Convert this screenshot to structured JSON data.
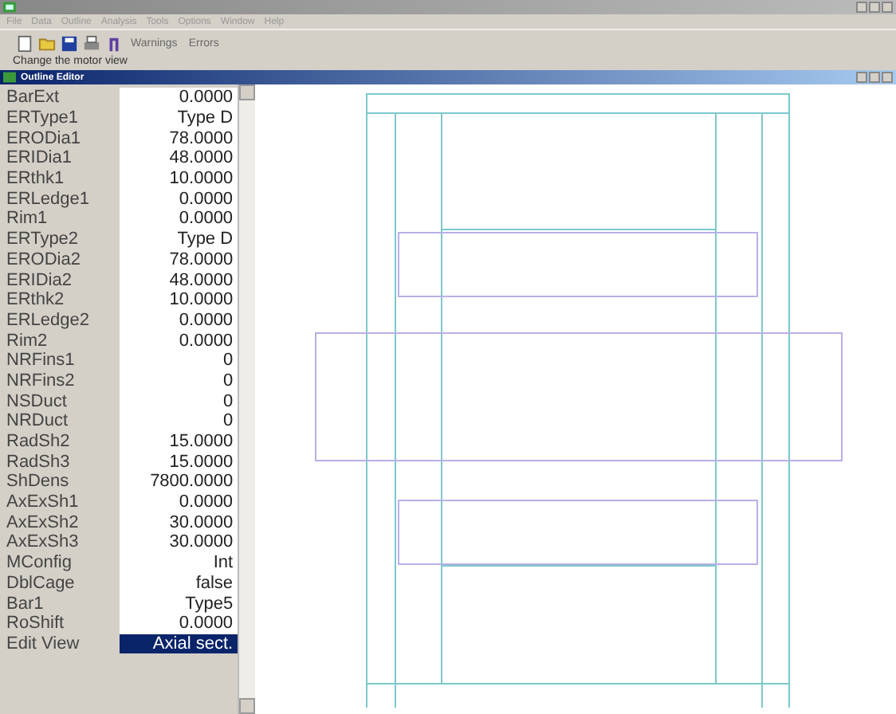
{
  "menu": [
    {
      "label": "File"
    },
    {
      "label": "Data"
    },
    {
      "label": "Outline"
    },
    {
      "label": "Analysis"
    },
    {
      "label": "Tools"
    },
    {
      "label": "Options"
    },
    {
      "label": "Window"
    },
    {
      "label": "Help"
    }
  ],
  "toolbar": {
    "buttons": [
      "Warnings",
      "Errors"
    ]
  },
  "hint": "Change the motor view",
  "editor": {
    "title": "Outline Editor",
    "properties": [
      {
        "name": "BarExt",
        "value": "0.0000",
        "selected": false
      },
      {
        "name": "ERType1",
        "value": "Type D",
        "selected": false
      },
      {
        "name": "ERODia1",
        "value": "78.0000",
        "selected": false
      },
      {
        "name": "ERIDia1",
        "value": "48.0000",
        "selected": false
      },
      {
        "name": "ERthk1",
        "value": "10.0000",
        "selected": false
      },
      {
        "name": "ERLedge1",
        "value": "0.0000",
        "selected": false
      },
      {
        "name": "Rim1",
        "value": "0.0000",
        "selected": false
      },
      {
        "name": "ERType2",
        "value": "Type D",
        "selected": false
      },
      {
        "name": "ERODia2",
        "value": "78.0000",
        "selected": false
      },
      {
        "name": "ERIDia2",
        "value": "48.0000",
        "selected": false
      },
      {
        "name": "ERthk2",
        "value": "10.0000",
        "selected": false
      },
      {
        "name": "ERLedge2",
        "value": "0.0000",
        "selected": false
      },
      {
        "name": "Rim2",
        "value": "0.0000",
        "selected": false
      },
      {
        "name": "NRFins1",
        "value": "0",
        "selected": false
      },
      {
        "name": "NRFins2",
        "value": "0",
        "selected": false
      },
      {
        "name": "NSDuct",
        "value": "0",
        "selected": false
      },
      {
        "name": "NRDuct",
        "value": "0",
        "selected": false
      },
      {
        "name": "RadSh2",
        "value": "15.0000",
        "selected": false
      },
      {
        "name": "RadSh3",
        "value": "15.0000",
        "selected": false
      },
      {
        "name": "ShDens",
        "value": "7800.0000",
        "selected": false
      },
      {
        "name": "AxExSh1",
        "value": "0.0000",
        "selected": false
      },
      {
        "name": "AxExSh2",
        "value": "30.0000",
        "selected": false
      },
      {
        "name": "AxExSh3",
        "value": "30.0000",
        "selected": false
      },
      {
        "name": "MConfig",
        "value": "Int",
        "selected": false
      },
      {
        "name": "DblCage",
        "value": "false",
        "selected": false
      },
      {
        "name": "Bar1",
        "value": "Type5",
        "selected": false
      },
      {
        "name": "RoShift",
        "value": "0.0000",
        "selected": false
      },
      {
        "name": "Edit View",
        "value": "Axial sect.",
        "selected": true
      }
    ]
  }
}
